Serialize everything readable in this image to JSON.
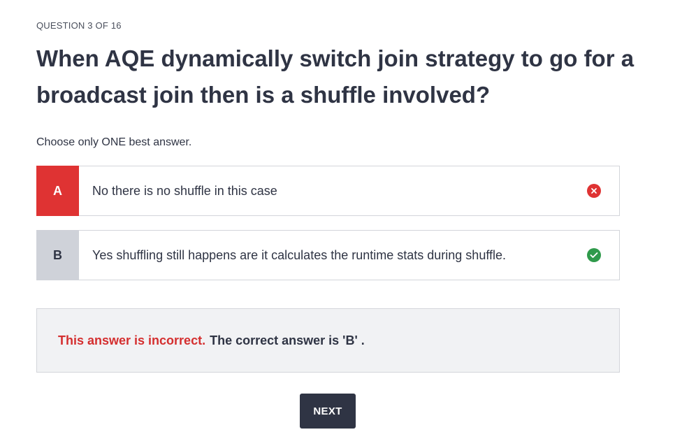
{
  "quiz": {
    "counter": "QUESTION 3 OF 16",
    "question": "When AQE dynamically switch join strategy to go for a broadcast join then is a shuffle involved?",
    "instruction": "Choose only ONE best answer.",
    "options": [
      {
        "letter": "A",
        "text": "No there is no shuffle in this case",
        "status": "incorrect",
        "status_icon": "x-circle-icon",
        "color": "#df3333"
      },
      {
        "letter": "B",
        "text": "Yes shuffling still happens are it calculates the runtime stats during shuffle.",
        "status": "correct",
        "status_icon": "check-circle-icon",
        "color": "#2f9a4b"
      }
    ],
    "feedback": {
      "incorrect_label": "This answer is incorrect.",
      "correct_answer_text": "The correct answer is 'B' ."
    },
    "next_label": "NEXT"
  }
}
